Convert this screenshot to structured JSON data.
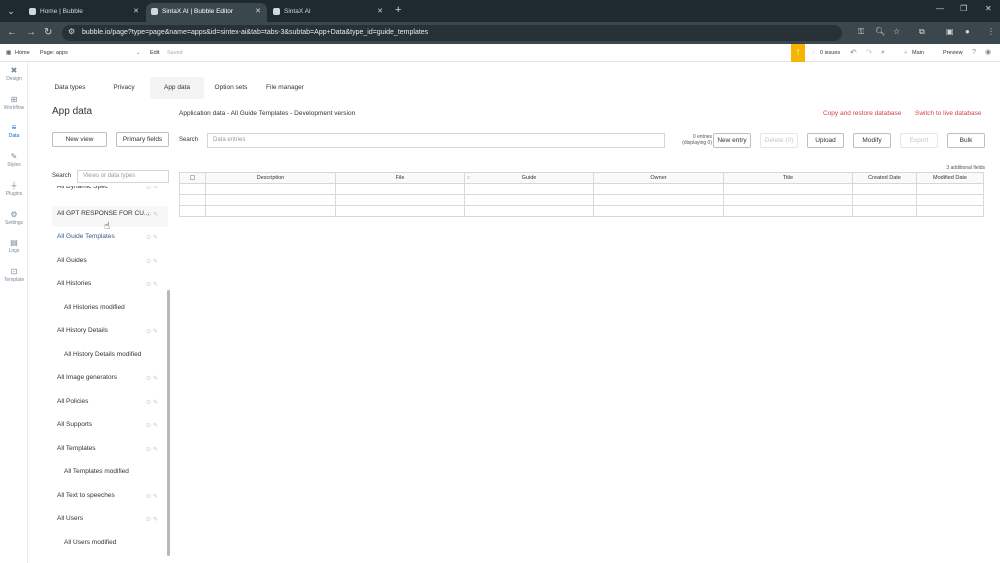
{
  "browser": {
    "tabs": [
      {
        "title": "Home | Bubble",
        "active": false
      },
      {
        "title": "SintaX AI | Bubble Editor",
        "active": true
      },
      {
        "title": "SintaX AI",
        "active": false
      }
    ],
    "url": "bubble.io/page?type=page&name=apps&id=sintex-ai&tab=tabs-3&subtab=App+Data&type_id=guide_templates"
  },
  "editor": {
    "home_label": "Home",
    "page_label": "Page: apps",
    "edit_label": "Edit",
    "saved_label": "Saved",
    "issues_label": "0 issues",
    "branch_label": "Main",
    "preview_label": "Preview"
  },
  "rail": [
    {
      "label": "Design",
      "icon": "design-icon",
      "active": false
    },
    {
      "label": "Workflow",
      "icon": "workflow-icon",
      "active": false
    },
    {
      "label": "Data",
      "icon": "data-icon",
      "active": true
    },
    {
      "label": "Styles",
      "icon": "styles-icon",
      "active": false
    },
    {
      "label": "Plugins",
      "icon": "plugins-icon",
      "active": false
    },
    {
      "label": "Settings",
      "icon": "settings-icon",
      "active": false
    },
    {
      "label": "Logs",
      "icon": "logs-icon",
      "active": false
    },
    {
      "label": "Template",
      "icon": "template-icon",
      "active": false
    }
  ],
  "subtabs": [
    "Data types",
    "Privacy",
    "App data",
    "Option sets",
    "File manager"
  ],
  "active_subtab": "App data",
  "panel": {
    "title": "App data",
    "new_view": "New view",
    "primary_fields": "Primary fields",
    "search_label": "Search",
    "search_placeholder": "Views or data types"
  },
  "types": [
    {
      "label": "All Dynamic Spec",
      "sub": false,
      "icons": true
    },
    {
      "label": "All GPT RESPONSE FOR CU...",
      "sub": false,
      "icons": true
    },
    {
      "label": "All Guide Templates",
      "sub": false,
      "icons": true
    },
    {
      "label": "All Guides",
      "sub": false,
      "icons": true
    },
    {
      "label": "All Histories",
      "sub": false,
      "icons": true
    },
    {
      "label": "All Histories modified",
      "sub": true,
      "icons": false
    },
    {
      "label": "All History Details",
      "sub": false,
      "icons": true
    },
    {
      "label": "All History Details modified",
      "sub": true,
      "icons": false
    },
    {
      "label": "All Image generators",
      "sub": false,
      "icons": true
    },
    {
      "label": "All Policies",
      "sub": false,
      "icons": true
    },
    {
      "label": "All Supports",
      "sub": false,
      "icons": true
    },
    {
      "label": "All Templates",
      "sub": false,
      "icons": true
    },
    {
      "label": "All Templates modified",
      "sub": true,
      "icons": false
    },
    {
      "label": "All Text to speeches",
      "sub": false,
      "icons": true
    },
    {
      "label": "All Users",
      "sub": false,
      "icons": true
    },
    {
      "label": "All Users modified",
      "sub": true,
      "icons": false
    }
  ],
  "main": {
    "info": "Application data - All Guide Templates - Development version",
    "copy_restore": "Copy and restore database",
    "switch_live": "Switch to live database",
    "search_label": "Search",
    "search_placeholder": "Data entries",
    "entries_count": "0 entries (displaying 0)",
    "new_entry": "New entry",
    "delete": "Delete (0)",
    "upload": "Upload",
    "modify": "Modify",
    "export": "Export",
    "bulk": "Bulk",
    "additional_fields": "3 additional fields",
    "columns": [
      "",
      "Description",
      "File",
      "Guide",
      "Owner",
      "Title",
      "Created Date",
      "Modified Date"
    ],
    "rows": 3
  }
}
